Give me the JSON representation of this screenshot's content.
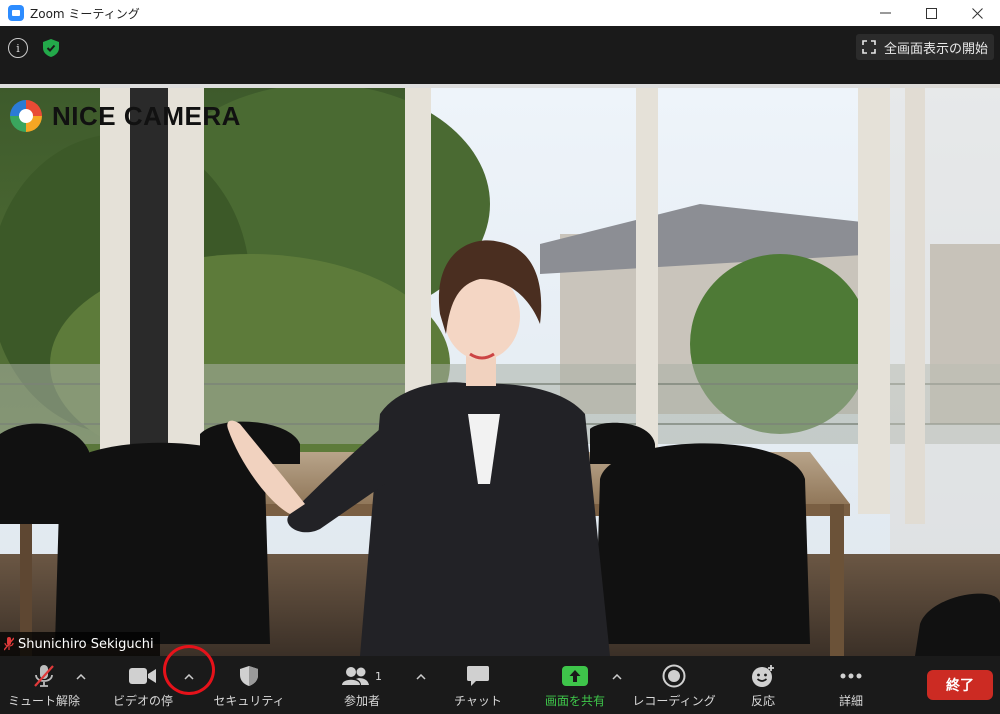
{
  "window": {
    "title": "Zoom ミーティング"
  },
  "topbar": {
    "fullscreen_label": "全画面表示の開始"
  },
  "video": {
    "background_logo": "NICE CAMERA",
    "participant_name": "Shunichiro Sekiguchi"
  },
  "toolbar": {
    "mute_label": "ミュート解除",
    "video_label": "ビデオの停",
    "security_label": "セキュリティ",
    "participants_label": "参加者",
    "participants_count": "1",
    "chat_label": "チャット",
    "share_label": "画面を共有",
    "record_label": "レコーディング",
    "reactions_label": "反応",
    "more_label": "詳細",
    "end_label": "終了"
  },
  "colors": {
    "share_green": "#3ec54a",
    "end_red": "#cc2b23",
    "zoom_blue": "#2D8CFF",
    "annotation_red": "#e6121a"
  },
  "icons": [
    "info-icon",
    "shield-check-icon",
    "fullscreen-icon",
    "mic-muted-icon",
    "video-camera-icon",
    "security-shield-icon",
    "participants-icon",
    "chat-icon",
    "share-screen-icon",
    "record-icon",
    "reactions-icon",
    "more-icon"
  ]
}
